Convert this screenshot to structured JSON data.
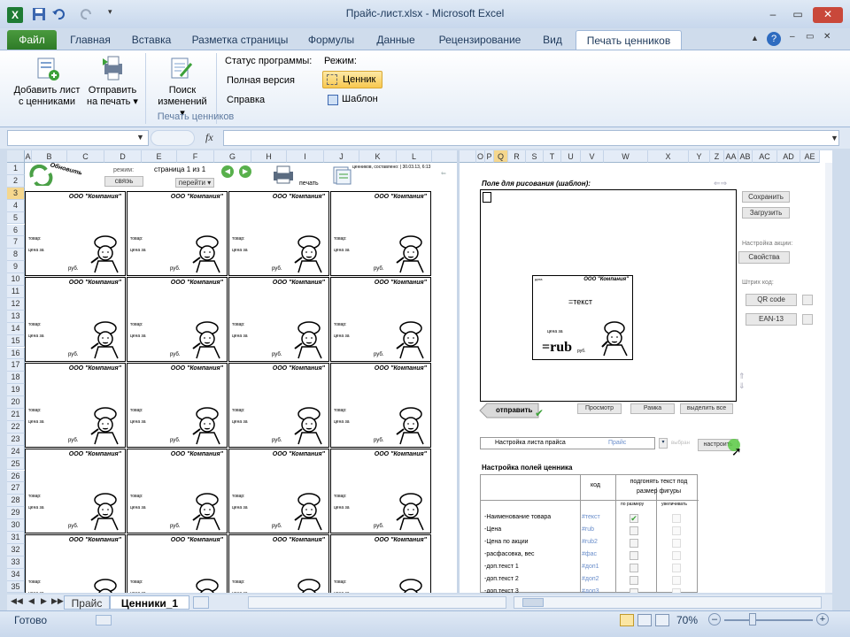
{
  "window": {
    "title": "Прайс-лист.xlsx - Microsoft Excel",
    "controls": [
      "–",
      "▭",
      "✕"
    ]
  },
  "tabs": [
    {
      "label": "Файл"
    },
    {
      "label": "Главная"
    },
    {
      "label": "Вставка"
    },
    {
      "label": "Разметка страницы"
    },
    {
      "label": "Формулы"
    },
    {
      "label": "Данные"
    },
    {
      "label": "Рецензирование"
    },
    {
      "label": "Вид"
    },
    {
      "label": "Печать ценников"
    }
  ],
  "ribbon": {
    "add_sheet": {
      "line1": "Добавить лист",
      "line2": "с ценниками"
    },
    "send_print": {
      "line1": "Отправить",
      "line2": "на печать ▾"
    },
    "search_changes": {
      "line1": "Поиск",
      "line2": "изменений ▾"
    },
    "status_label": "Статус программы:",
    "full_version": "Полная версия",
    "help": "Справка",
    "mode_label": "Режим:",
    "mode_tag": "Ценник",
    "mode_template": "Шаблон",
    "group_label": "Печать ценников"
  },
  "formula_bar": {
    "fx": "fx",
    "name_box": "",
    "formula": ""
  },
  "columns": [
    "A",
    "B",
    "C",
    "D",
    "E",
    "F",
    "G",
    "H",
    "I",
    "J",
    "K",
    "L",
    "",
    "O",
    "P",
    "Q",
    "R",
    "S",
    "T",
    "U",
    "V",
    "W",
    "X",
    "Y",
    "Z",
    "AA",
    "AB",
    "AC",
    "AD",
    "AE"
  ],
  "rows": [
    "1",
    "2",
    "3",
    "4",
    "5",
    "6",
    "7",
    "8",
    "9",
    "10",
    "11",
    "12",
    "13",
    "14",
    "15",
    "16",
    "17",
    "18",
    "19",
    "20",
    "21",
    "22",
    "23",
    "24",
    "25",
    "26",
    "27",
    "28",
    "29",
    "30",
    "31",
    "32",
    "33",
    "34",
    "35"
  ],
  "toolbar_sheet": {
    "refresh": "Обновить",
    "mode_label": "режим:",
    "mode_value": "свяэь",
    "page_label": "страница 1 из 1",
    "goto": "перейти ▾",
    "print": "печать",
    "created": "ценников, составлено: | 30.03.13, 6:13"
  },
  "price_tag": {
    "company": "ООО \"Компания\"",
    "line_name": "товар:",
    "line_price": "цена за",
    "rub": "руб."
  },
  "right_panel": {
    "draw_title": "Поле для рисования (шаблон):",
    "template_company": "ООО \"Компания\"",
    "template_date": "дата",
    "template_text": "=текст",
    "template_price_for": "цена за",
    "template_rub": "=rub",
    "template_rub_small": "руб.",
    "save": "Сохранить",
    "load": "Загрузить",
    "promo_label": "Настройка акции:",
    "properties": "Свойства",
    "barcode_label": "Штрих код:",
    "qr": "QR code",
    "ean": "EAN-13",
    "send": "отправить",
    "preview": "Просмотр",
    "frame": "Рамка",
    "select_all": "выделить все",
    "sheet_settings": "Настройка листа прайса",
    "price_sheet": "Прайс",
    "selected": "выбран",
    "setup": "настроить",
    "fields_title": "Настройка полей ценника",
    "col_code": "код",
    "col_fit": "подгонять текст под размер фигуры",
    "col_shrink": "по размеру",
    "col_grow": "увеличивать",
    "fields": [
      {
        "name": "-Наименование товара",
        "code": "#текст"
      },
      {
        "name": "-Цена",
        "code": "#rub"
      },
      {
        "name": "-Цена по акции",
        "code": "#rub2"
      },
      {
        "name": "-расфасовка, вес",
        "code": "#фас"
      },
      {
        "name": "-доп.текст 1",
        "code": "#доп1"
      },
      {
        "name": "-доп.текст 2",
        "code": "#доп2"
      },
      {
        "name": "-доп.текст 3",
        "code": "#доп3"
      }
    ]
  },
  "sheet_tabs": [
    "Прайс",
    "Ценники_1"
  ],
  "status": {
    "ready": "Готово",
    "zoom": "70%"
  }
}
